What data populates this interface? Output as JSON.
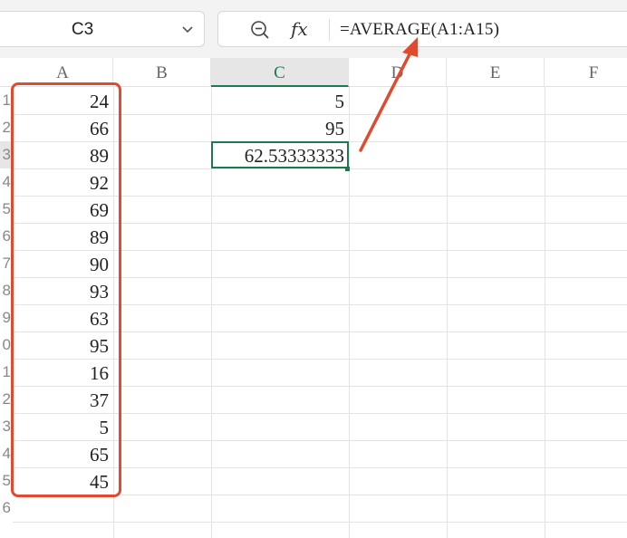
{
  "name_box": {
    "value": "C3"
  },
  "formula_bar": {
    "formula": "=AVERAGE(A1:A15)"
  },
  "columns": [
    "A",
    "B",
    "C",
    "D",
    "E",
    "F"
  ],
  "active_column": "C",
  "row_labels": [
    "1",
    "2",
    "3",
    "4",
    "5",
    "6",
    "7",
    "8",
    "9",
    "0",
    "1",
    "2",
    "3",
    "4",
    "5",
    "6"
  ],
  "active_row": 3,
  "column_a": [
    "24",
    "66",
    "89",
    "92",
    "69",
    "89",
    "90",
    "93",
    "63",
    "95",
    "16",
    "37",
    "5",
    "65",
    "45"
  ],
  "column_c": [
    "5",
    "95",
    "62.53333333"
  ],
  "selected_cell": "C3",
  "annotation": {
    "box_color": "#e04a2e",
    "arrow_color": "#e04a2e"
  },
  "accent_color": "#1d7a4c"
}
